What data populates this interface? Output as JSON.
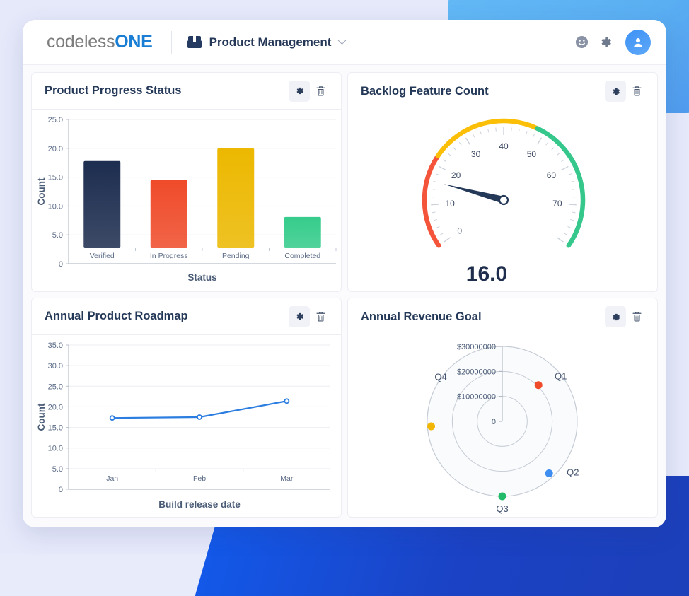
{
  "topbar": {
    "brand_primary": "codeless",
    "brand_accent": "ONE",
    "workspace_icon": "briefcase-icon",
    "workspace_name": "Product Management",
    "dropdown_icon": "chevron-down-icon",
    "smiley_icon": "smiley-face-icon",
    "gear_icon": "gear-icon",
    "avatar_icon": "user-avatar-icon",
    "accent_color": "#1a7fd4",
    "avatar_color": "#3d92f5"
  },
  "panels": [
    {
      "title": "Product Progress Status",
      "gear_label": "settings-icon",
      "delete_label": "trash-icon"
    },
    {
      "title": "Backlog Feature Count",
      "gear_label": "settings-icon",
      "delete_label": "trash-icon"
    },
    {
      "title": "Annual Product Roadmap",
      "gear_label": "settings-icon",
      "delete_label": "trash-icon"
    },
    {
      "title": "Annual Revenue Goal",
      "gear_label": "settings-icon",
      "delete_label": "trash-icon"
    }
  ],
  "chart_data": [
    {
      "type": "bar",
      "title": "Product Progress Status",
      "categories": [
        "Verified",
        "In Progress",
        "Pending",
        "Completed"
      ],
      "values": [
        17.8,
        14.5,
        20.0,
        8.1
      ],
      "colors": [
        "#1d2d4f",
        "#ef4b2a",
        "#ecb800",
        "#35cc8b"
      ],
      "xlabel": "Status",
      "ylabel": "Count",
      "ylim": [
        0,
        25
      ],
      "yticks": [
        "0",
        "5.0",
        "10.0",
        "15.0",
        "20.0",
        "25.0"
      ],
      "grid": true,
      "legend": "none"
    },
    {
      "type": "gauge",
      "title": "Backlog Feature Count",
      "value": 16.0,
      "value_label": "16.0",
      "min": 0,
      "max": 80,
      "ticks": [
        "0",
        "10",
        "20",
        "30",
        "40",
        "50",
        "60",
        "70"
      ],
      "bands": [
        {
          "from": 0,
          "to": 22,
          "color": "#f4553a"
        },
        {
          "from": 22,
          "to": 48,
          "color": "#fcbf08"
        },
        {
          "from": 48,
          "to": 80,
          "color": "#35c78b"
        }
      ],
      "needle_color": "#243858"
    },
    {
      "type": "line",
      "title": "Annual Product Roadmap",
      "categories": [
        "Jan",
        "Feb",
        "Mar"
      ],
      "values": [
        17.3,
        17.5,
        21.4
      ],
      "series_color": "#2b7de0",
      "xlabel": "Build release date",
      "ylabel": "Count",
      "ylim": [
        0,
        35
      ],
      "yticks": [
        "0",
        "5.0",
        "10.0",
        "15.0",
        "20.0",
        "25.0",
        "30.0",
        "35.0"
      ],
      "grid": true,
      "legend": "none"
    },
    {
      "type": "scatter",
      "subtype": "polar",
      "title": "Annual Revenue Goal",
      "categories": [
        "Q1",
        "Q2",
        "Q3",
        "Q4"
      ],
      "values": [
        20500000,
        28000000,
        30000000,
        28500000
      ],
      "colors": [
        "#ef4b2a",
        "#3d8ef0",
        "#22bb6a",
        "#f2b705"
      ],
      "rticks": [
        "0",
        "$10000000",
        "$20000000",
        "$30000000"
      ],
      "rlim": [
        0,
        30000000
      ],
      "grid": true,
      "legend": "none"
    }
  ]
}
